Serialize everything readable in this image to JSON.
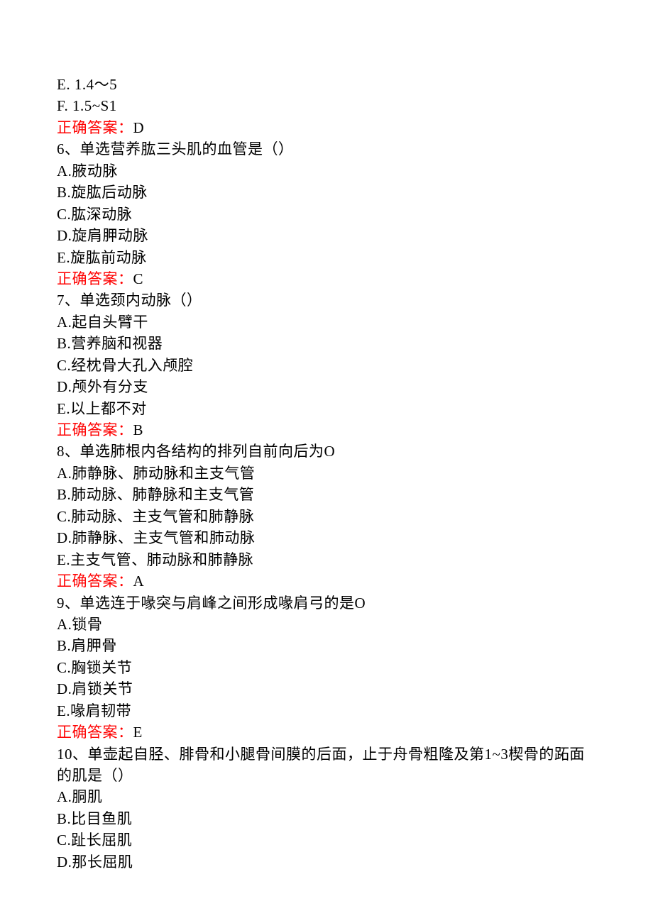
{
  "lines": [
    {
      "text": "E. 1.4～5"
    },
    {
      "text": "F. 1.5~S1"
    },
    {
      "answer_prefix": "正确答案：",
      "answer_value": "D"
    },
    {
      "text": "6、单选营养肱三头肌的血管是（）"
    },
    {
      "text": "A.腋动脉"
    },
    {
      "text": "B.旋肱后动脉"
    },
    {
      "text": "C.肱深动脉"
    },
    {
      "text": "D.旋肩胛动脉"
    },
    {
      "text": "E.旋肱前动脉"
    },
    {
      "answer_prefix": "正确答案：",
      "answer_value": "C"
    },
    {
      "text": "7、单选颈内动脉（）"
    },
    {
      "text": "A.起自头臂干"
    },
    {
      "text": "B.营养脑和视器"
    },
    {
      "text": "C.经枕骨大孔入颅腔"
    },
    {
      "text": "D.颅外有分支"
    },
    {
      "text": "E.以上都不对"
    },
    {
      "answer_prefix": "正确答案：",
      "answer_value": "B"
    },
    {
      "text": "8、单选肺根内各结构的排列自前向后为O"
    },
    {
      "text": "A.肺静脉、肺动脉和主支气管"
    },
    {
      "text": "B.肺动脉、肺静脉和主支气管"
    },
    {
      "text": "C.肺动脉、主支气管和肺静脉"
    },
    {
      "text": "D.肺静脉、主支气管和肺动脉"
    },
    {
      "text": "E.主支气管、肺动脉和肺静脉"
    },
    {
      "answer_prefix": "正确答案：",
      "answer_value": "A"
    },
    {
      "text": "9、单选连于喙突与肩峰之间形成喙肩弓的是O"
    },
    {
      "text": "A.锁骨"
    },
    {
      "text": "B.肩胛骨"
    },
    {
      "text": "C.胸锁关节"
    },
    {
      "text": "D.肩锁关节"
    },
    {
      "text": "E.喙肩韧带"
    },
    {
      "answer_prefix": "正确答案：",
      "answer_value": "E"
    },
    {
      "text": "10、单壶起自胫、腓骨和小腿骨间膜的后面，止于舟骨粗隆及第1~3楔骨的跖面的肌是（）"
    },
    {
      "text": "A.胴肌"
    },
    {
      "text": "B.比目鱼肌"
    },
    {
      "text": "C.趾长屈肌"
    },
    {
      "text": "D.那长屈肌"
    }
  ]
}
